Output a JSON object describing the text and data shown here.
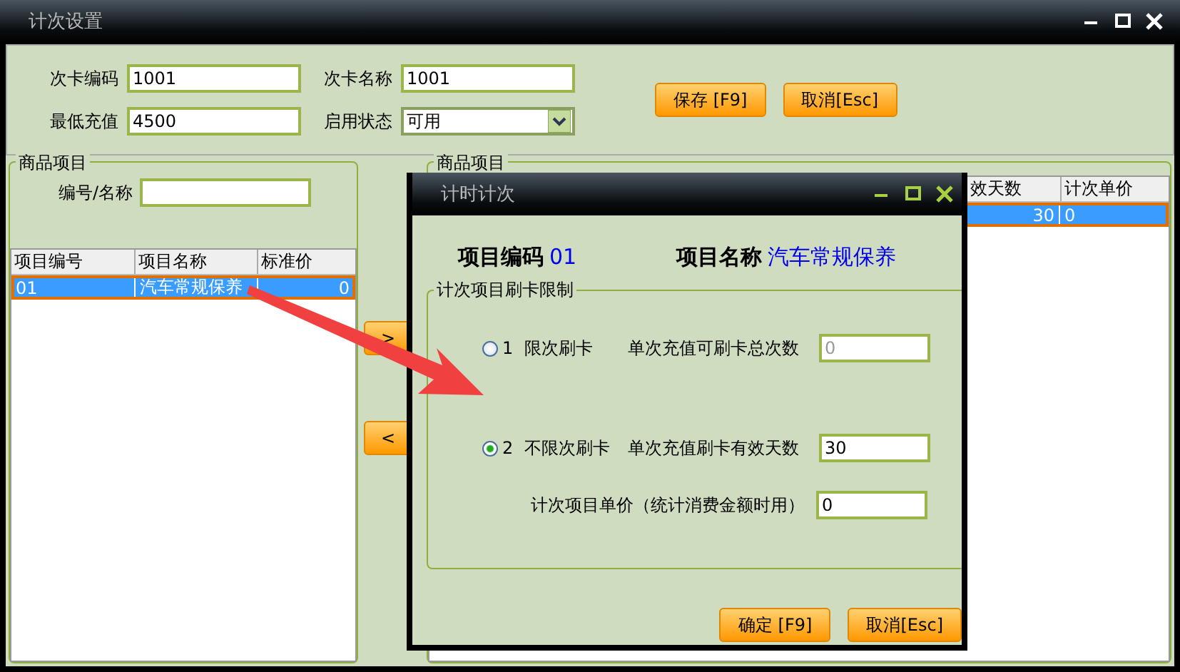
{
  "window": {
    "title": "计次设置"
  },
  "card_form": {
    "fields": [
      {
        "label": "次卡编码",
        "value": "1001",
        "kind": "text"
      },
      {
        "label": "次卡名称",
        "value": "1001",
        "kind": "text"
      },
      {
        "label": "最低充值",
        "value": "4500",
        "kind": "text"
      },
      {
        "label": "启用状态",
        "value": "可用",
        "kind": "select"
      }
    ],
    "buttons": [
      "保存 [F9]",
      "取消[Esc]"
    ]
  },
  "product_items": {
    "title": "商品项目",
    "search_label": "编号/名称",
    "table": {
      "columns": [
        "项目编号",
        "项目名称",
        "标准价"
      ],
      "rows": [
        {
          "cells": [
            "01",
            "汽车常规保养",
            "0"
          ],
          "selected": true
        }
      ]
    }
  },
  "move_buttons": [
    ">",
    "<"
  ],
  "selected_items": {
    "title": "商品项目",
    "table": {
      "columns": [
        "效天数",
        "计次单价"
      ],
      "rows": [
        {
          "cells": [
            "30",
            "0"
          ],
          "selected": true
        }
      ]
    }
  },
  "dialog": {
    "title": "计时计次",
    "code_label": "项目编码",
    "code": "01",
    "name_label": "项目名称",
    "name": "汽车常规保养",
    "group_title": "计次项目刷卡限制",
    "options": [
      {
        "label": "1  限次刷卡",
        "selected": false,
        "field_label": "单次充值可刷卡总次数",
        "value": "0",
        "disabled": true
      },
      {
        "label": "2  不限次刷卡",
        "selected": true,
        "field_label": "单次充值刷卡有效天数",
        "value": "30",
        "disabled": false
      }
    ],
    "price_label": "计次项目单价（统计消费金额时用）",
    "price": "0",
    "buttons": [
      "确定 [F9]",
      "取消[Esc]"
    ]
  }
}
